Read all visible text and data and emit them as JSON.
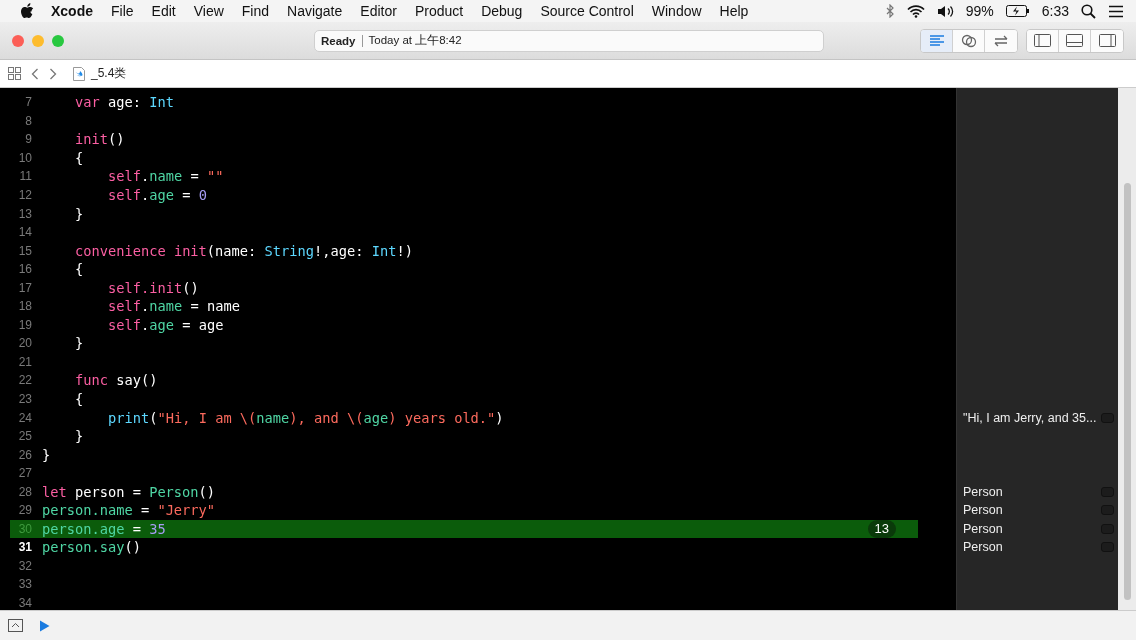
{
  "menu_bar": {
    "app": "Xcode",
    "items": [
      "File",
      "Edit",
      "View",
      "Find",
      "Navigate",
      "Editor",
      "Product",
      "Debug",
      "Source Control",
      "Window",
      "Help"
    ],
    "battery": "99%",
    "clock": "6:33"
  },
  "toolbar": {
    "status": "Ready",
    "timestamp": "Today at 上午8:42",
    "editor_modes": [
      {
        "kind": "standard",
        "selected": true
      },
      {
        "kind": "assistant",
        "selected": false
      },
      {
        "kind": "version",
        "selected": false
      }
    ]
  },
  "jump_bar": {
    "file": "_5.4类"
  },
  "editor": {
    "lines": [
      {
        "number": "7",
        "kind": "member",
        "current": false,
        "highlighted": false,
        "tokens": [
          {
            "kind": "kw",
            "text": "var"
          },
          {
            "kind": "plain",
            "text": " age: "
          },
          {
            "kind": "type",
            "text": "Int"
          }
        ]
      },
      {
        "number": "8",
        "current": false,
        "highlighted": false
      },
      {
        "number": "9",
        "kind": "member",
        "current": false,
        "highlighted": false,
        "tokens": [
          {
            "kind": "kw",
            "text": "init"
          },
          {
            "kind": "plain",
            "text": "()"
          }
        ]
      },
      {
        "number": "10",
        "kind": "member",
        "current": false,
        "highlighted": false,
        "tokens": [
          {
            "kind": "plain",
            "text": "{"
          }
        ]
      },
      {
        "number": "11",
        "kind": "body",
        "current": false,
        "highlighted": false,
        "tokens": [
          {
            "kind": "kw",
            "text": "self"
          },
          {
            "kind": "plain",
            "text": "."
          },
          {
            "kind": "prop",
            "text": "name"
          },
          {
            "kind": "plain",
            "text": " = "
          },
          {
            "kind": "str",
            "text": "\"\""
          }
        ]
      },
      {
        "number": "12",
        "kind": "body",
        "current": false,
        "highlighted": false,
        "tokens": [
          {
            "kind": "kw",
            "text": "self"
          },
          {
            "kind": "plain",
            "text": "."
          },
          {
            "kind": "prop",
            "text": "age"
          },
          {
            "kind": "plain",
            "text": " = "
          },
          {
            "kind": "num",
            "text": "0"
          }
        ]
      },
      {
        "number": "13",
        "kind": "member",
        "current": false,
        "highlighted": false,
        "tokens": [
          {
            "kind": "plain",
            "text": "}"
          }
        ]
      },
      {
        "number": "14",
        "current": false,
        "highlighted": false
      },
      {
        "number": "15",
        "kind": "member",
        "current": false,
        "highlighted": false,
        "tokens": [
          {
            "kind": "kw",
            "text": "convenience init"
          },
          {
            "kind": "plain",
            "text": "(name: "
          },
          {
            "kind": "type",
            "text": "String"
          },
          {
            "kind": "plain",
            "text": "!,age: "
          },
          {
            "kind": "type",
            "text": "Int"
          },
          {
            "kind": "plain",
            "text": "!)"
          }
        ]
      },
      {
        "number": "16",
        "kind": "member",
        "current": false,
        "highlighted": false,
        "tokens": [
          {
            "kind": "plain",
            "text": "{"
          }
        ]
      },
      {
        "number": "17",
        "kind": "body",
        "current": false,
        "highlighted": false,
        "tokens": [
          {
            "kind": "kw",
            "text": "self.init"
          },
          {
            "kind": "plain",
            "text": "()"
          }
        ]
      },
      {
        "number": "18",
        "kind": "body",
        "current": false,
        "highlighted": false,
        "tokens": [
          {
            "kind": "kw",
            "text": "self"
          },
          {
            "kind": "plain",
            "text": "."
          },
          {
            "kind": "prop",
            "text": "name"
          },
          {
            "kind": "plain",
            "text": " = name"
          }
        ]
      },
      {
        "number": "19",
        "kind": "body",
        "current": false,
        "highlighted": false,
        "tokens": [
          {
            "kind": "kw",
            "text": "self"
          },
          {
            "kind": "plain",
            "text": "."
          },
          {
            "kind": "prop",
            "text": "age"
          },
          {
            "kind": "plain",
            "text": " = age"
          }
        ]
      },
      {
        "number": "20",
        "kind": "member",
        "current": false,
        "highlighted": false,
        "tokens": [
          {
            "kind": "plain",
            "text": "}"
          }
        ]
      },
      {
        "number": "21",
        "current": false,
        "highlighted": false
      },
      {
        "number": "22",
        "kind": "member",
        "current": false,
        "highlighted": false,
        "tokens": [
          {
            "kind": "kw",
            "text": "func"
          },
          {
            "kind": "plain",
            "text": " say()"
          }
        ]
      },
      {
        "number": "23",
        "kind": "member",
        "current": false,
        "highlighted": false,
        "tokens": [
          {
            "kind": "plain",
            "text": "{"
          }
        ]
      },
      {
        "number": "24",
        "kind": "body",
        "current": false,
        "highlighted": false,
        "result": "\"Hi, I am Jerry, and 35...",
        "tokens": [
          {
            "kind": "type",
            "text": "print"
          },
          {
            "kind": "plain",
            "text": "("
          },
          {
            "kind": "str",
            "text": "\"Hi, I am \\("
          },
          {
            "kind": "prop",
            "text": "name"
          },
          {
            "kind": "str",
            "text": "), and \\("
          },
          {
            "kind": "prop",
            "text": "age"
          },
          {
            "kind": "str",
            "text": ") years old.\""
          },
          {
            "kind": "plain",
            "text": ")"
          }
        ]
      },
      {
        "number": "25",
        "kind": "member",
        "current": false,
        "highlighted": false,
        "tokens": [
          {
            "kind": "plain",
            "text": "}"
          }
        ]
      },
      {
        "number": "26",
        "kind": "top",
        "current": false,
        "highlighted": false,
        "tokens": [
          {
            "kind": "plain",
            "text": "}"
          }
        ]
      },
      {
        "number": "27",
        "current": false,
        "highlighted": false
      },
      {
        "number": "28",
        "kind": "top",
        "current": false,
        "highlighted": false,
        "result": "Person",
        "tokens": [
          {
            "kind": "kw",
            "text": "let"
          },
          {
            "kind": "plain",
            "text": " person = "
          },
          {
            "kind": "prop",
            "text": "Person"
          },
          {
            "kind": "plain",
            "text": "()"
          }
        ]
      },
      {
        "number": "29",
        "kind": "top",
        "current": false,
        "highlighted": false,
        "result": "Person",
        "tokens": [
          {
            "kind": "prop",
            "text": "person.name"
          },
          {
            "kind": "plain",
            "text": " = "
          },
          {
            "kind": "str",
            "text": "\"Jerry\""
          }
        ]
      },
      {
        "number": "30",
        "kind": "top",
        "current": false,
        "highlighted": true,
        "badge": "13",
        "result": "Person",
        "tokens": [
          {
            "kind": "prop",
            "text": "person.age"
          },
          {
            "kind": "plain",
            "text": " = "
          },
          {
            "kind": "num",
            "text": "35"
          }
        ]
      },
      {
        "number": "31",
        "kind": "top",
        "current": true,
        "highlighted": false,
        "result": "Person",
        "tokens": [
          {
            "kind": "prop",
            "text": "person.say"
          },
          {
            "kind": "plain",
            "text": "()"
          }
        ]
      },
      {
        "number": "32",
        "current": false,
        "highlighted": false
      },
      {
        "number": "33",
        "current": false,
        "highlighted": false
      },
      {
        "number": "34",
        "current": false,
        "highlighted": false
      }
    ]
  }
}
